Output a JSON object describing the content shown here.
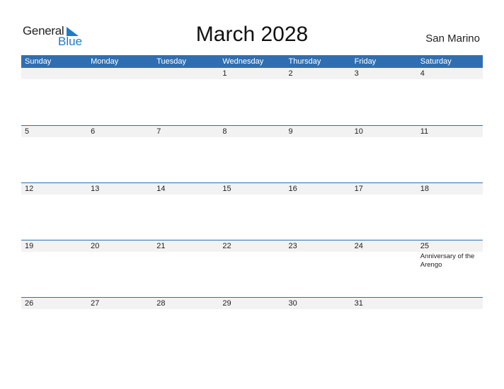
{
  "logo": {
    "line1": "General",
    "line2": "Blue",
    "accent_color": "#1f7acb"
  },
  "title": "March 2028",
  "country": "San Marino",
  "header_color": "#2f6fb1",
  "weekdays": [
    "Sunday",
    "Monday",
    "Tuesday",
    "Wednesday",
    "Thursday",
    "Friday",
    "Saturday"
  ],
  "weeks": [
    [
      {
        "day": ""
      },
      {
        "day": ""
      },
      {
        "day": ""
      },
      {
        "day": "1"
      },
      {
        "day": "2"
      },
      {
        "day": "3"
      },
      {
        "day": "4"
      }
    ],
    [
      {
        "day": "5"
      },
      {
        "day": "6"
      },
      {
        "day": "7"
      },
      {
        "day": "8"
      },
      {
        "day": "9"
      },
      {
        "day": "10"
      },
      {
        "day": "11"
      }
    ],
    [
      {
        "day": "12"
      },
      {
        "day": "13"
      },
      {
        "day": "14"
      },
      {
        "day": "15"
      },
      {
        "day": "16"
      },
      {
        "day": "17"
      },
      {
        "day": "18"
      }
    ],
    [
      {
        "day": "19"
      },
      {
        "day": "20"
      },
      {
        "day": "21"
      },
      {
        "day": "22"
      },
      {
        "day": "23"
      },
      {
        "day": "24"
      },
      {
        "day": "25",
        "event": "Anniversary of the Arengo"
      }
    ],
    [
      {
        "day": "26"
      },
      {
        "day": "27"
      },
      {
        "day": "28"
      },
      {
        "day": "29"
      },
      {
        "day": "30"
      },
      {
        "day": "31"
      },
      {
        "day": ""
      }
    ]
  ]
}
